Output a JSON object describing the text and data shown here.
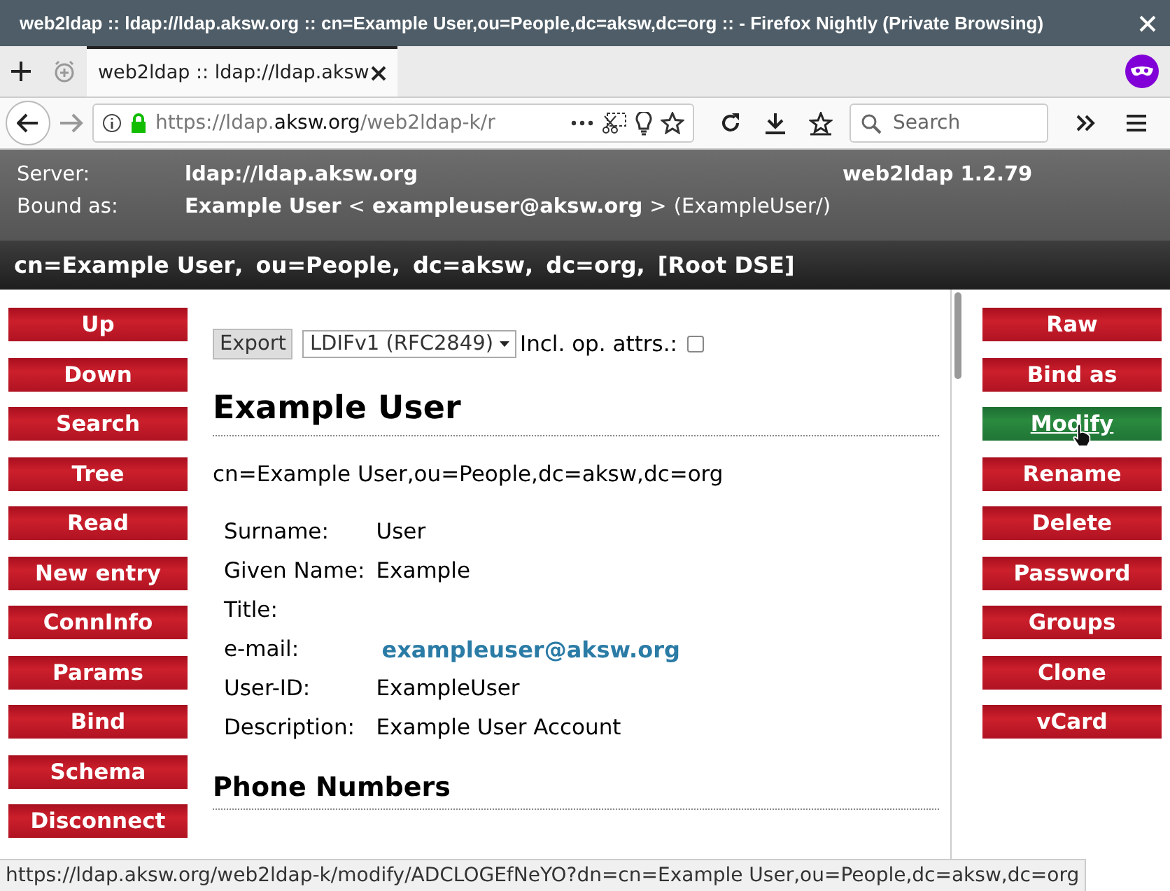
{
  "window": {
    "title": "web2ldap :: ldap://ldap.aksw.org :: cn=Example User,ou=People,dc=aksw,dc=org :: - Firefox Nightly (Private Browsing)"
  },
  "tabs": [
    {
      "label": "web2ldap :: ldap://ldap.aksw",
      "selected": true
    }
  ],
  "address_bar": {
    "url_host_pre": "https://ldap.",
    "url_host": "aksw.org",
    "url_path": "/web2ldap-k/r"
  },
  "search": {
    "placeholder": "Search"
  },
  "header": {
    "server_label": "Server:",
    "server": "ldap://ldap.aksw.org",
    "version": "web2ldap 1.2.79",
    "bound_label": "Bound as:",
    "bound_name": "Example User",
    "bound_lt": "<",
    "bound_email": "exampleuser@aksw.org",
    "bound_gt": ">",
    "bound_id": "(ExampleUser/)"
  },
  "breadcrumb": {
    "separator": ",",
    "items": [
      "cn=Example User",
      "ou=People",
      "dc=aksw",
      "dc=org",
      "[Root DSE]"
    ]
  },
  "left_buttons": [
    {
      "label": "Up",
      "hovered": false
    },
    {
      "label": "Down",
      "hovered": false
    },
    {
      "label": "Search",
      "hovered": false
    },
    {
      "label": "Tree",
      "hovered": false
    },
    {
      "label": "Read",
      "hovered": false
    },
    {
      "label": "New entry",
      "hovered": false
    },
    {
      "label": "ConnInfo",
      "hovered": false
    },
    {
      "label": "Params",
      "hovered": false
    },
    {
      "label": "Bind",
      "hovered": false
    },
    {
      "label": "Schema",
      "hovered": false
    },
    {
      "label": "Disconnect",
      "hovered": false
    }
  ],
  "right_buttons": [
    {
      "label": "Raw",
      "hovered": false
    },
    {
      "label": "Bind as",
      "hovered": false
    },
    {
      "label": "Modify",
      "hovered": true
    },
    {
      "label": "Rename",
      "hovered": false
    },
    {
      "label": "Delete",
      "hovered": false
    },
    {
      "label": "Password",
      "hovered": false
    },
    {
      "label": "Groups",
      "hovered": false
    },
    {
      "label": "Clone",
      "hovered": false
    },
    {
      "label": "vCard",
      "hovered": false
    }
  ],
  "export": {
    "button": "Export",
    "format": "LDIFv1 (RFC2849)",
    "op_attrs_label": "Incl. op. attrs.:",
    "op_attrs_checked": false
  },
  "entry": {
    "title": "Example User",
    "dn": "cn=Example User,ou=People,dc=aksw,dc=org",
    "attributes": [
      {
        "label": "Surname:",
        "value": "User",
        "kind": "text"
      },
      {
        "label": "Given Name:",
        "value": "Example",
        "kind": "text"
      },
      {
        "label": "Title:",
        "kind": "text"
      },
      {
        "label": "e-mail:",
        "value": "exampleuser@aksw.org",
        "kind": "link"
      },
      {
        "label": "User-ID:",
        "value": "ExampleUser",
        "kind": "text"
      },
      {
        "label": "Description:",
        "value": "Example User Account",
        "kind": "text"
      }
    ],
    "section": "Phone Numbers"
  },
  "status_bar": "https://ldap.aksw.org/web2ldap-k/modify/ADCLOGEfNeYO?dn=cn=Example User,ou=People,dc=aksw,dc=org"
}
